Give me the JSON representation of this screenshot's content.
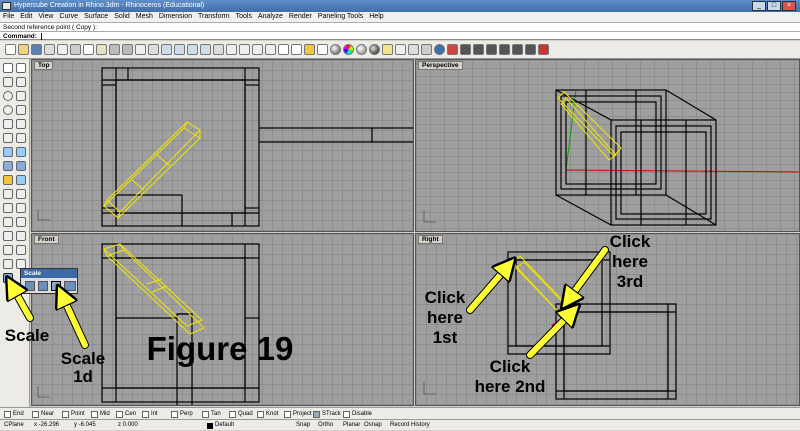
{
  "window": {
    "title": "Hypercube Creation in Rhino.3dm - Rhinoceros (Educational)"
  },
  "menu": [
    "File",
    "Edit",
    "View",
    "Curve",
    "Surface",
    "Solid",
    "Mesh",
    "Dimension",
    "Transform",
    "Tools",
    "Analyze",
    "Render",
    "Paneling Tools",
    "Help"
  ],
  "command": {
    "history": "Second reference point ( Copy ):",
    "prompt": "Command:",
    "value": ""
  },
  "viewports": {
    "top": "Top",
    "perspective": "Perspective",
    "front": "Front",
    "right": "Right"
  },
  "scale_popup": {
    "title": "Scale"
  },
  "osnaps": [
    {
      "label": "End",
      "checked": false
    },
    {
      "label": "Near",
      "checked": false
    },
    {
      "label": "Point",
      "checked": false
    },
    {
      "label": "Mid",
      "checked": false
    },
    {
      "label": "Cen",
      "checked": false
    },
    {
      "label": "Int",
      "checked": false
    },
    {
      "label": "Perp",
      "checked": false
    },
    {
      "label": "Tan",
      "checked": false
    },
    {
      "label": "Quad",
      "checked": false
    },
    {
      "label": "Knot",
      "checked": false
    },
    {
      "label": "Project",
      "checked": false
    },
    {
      "label": "STrack",
      "checked": true
    },
    {
      "label": "Disable",
      "checked": false
    }
  ],
  "status": {
    "cplane": "CPlane",
    "x": "x -26.296",
    "y": "y -6.045",
    "z": "z 0.000",
    "layer": "Default",
    "snap": "Snap",
    "ortho": "Ortho",
    "planar": "Planar",
    "osnap": "Osnap",
    "record": "Record History"
  },
  "annotations": {
    "figure": "Figure 19",
    "scale": "Scale",
    "scale_1d_line1": "Scale",
    "scale_1d_line2": "1d",
    "click1_l1": "Click",
    "click1_l2": "here",
    "click1_l3": "1st",
    "click2_l1": "Click",
    "click2_l2": "here 2nd",
    "click3_l1": "Click",
    "click3_l2": "here",
    "click3_l3": "3rd"
  },
  "colors": {
    "selection": "#f2e600",
    "arrow": "#ffff33",
    "wire": "#000000",
    "viewport_bg": "#9f9f9f",
    "titlebar": "#4a7ab5",
    "red_axis": "#cc0000"
  }
}
